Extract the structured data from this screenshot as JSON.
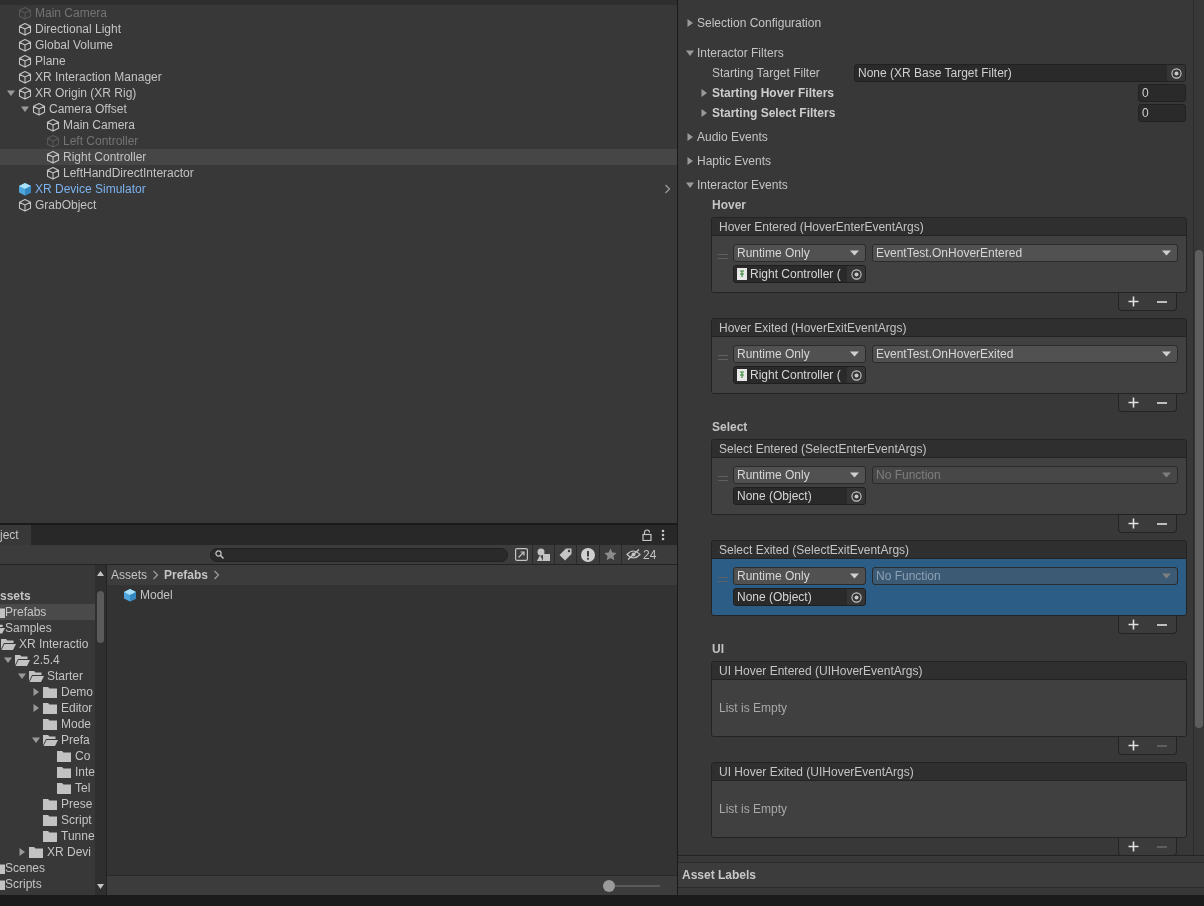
{
  "hierarchy": {
    "items": [
      {
        "label": "Main Camera",
        "kind": "object",
        "disabled": true,
        "selected": false
      },
      {
        "label": "Directional Light",
        "kind": "object",
        "disabled": false,
        "selected": false
      },
      {
        "label": "Global Volume",
        "kind": "object",
        "disabled": false,
        "selected": false
      },
      {
        "label": "Plane",
        "kind": "object",
        "disabled": false,
        "selected": false
      },
      {
        "label": "XR Interaction Manager",
        "kind": "object",
        "disabled": false,
        "selected": false
      },
      {
        "label": "XR Origin (XR Rig)",
        "kind": "object",
        "disabled": false,
        "selected": false,
        "expanded": true,
        "children": [
          {
            "label": "Camera Offset",
            "kind": "object",
            "disabled": false,
            "selected": false,
            "expanded": true,
            "children": [
              {
                "label": "Main Camera",
                "kind": "object",
                "disabled": false,
                "selected": false
              },
              {
                "label": "Left Controller",
                "kind": "object",
                "disabled": true,
                "selected": false
              },
              {
                "label": "Right Controller",
                "kind": "object",
                "disabled": false,
                "selected": true
              },
              {
                "label": "LeftHandDirectInteractor",
                "kind": "object",
                "disabled": false,
                "selected": false
              }
            ]
          }
        ]
      },
      {
        "label": "XR Device Simulator",
        "kind": "prefab",
        "disabled": false,
        "selected": false
      },
      {
        "label": "GrabObject",
        "kind": "object",
        "disabled": false,
        "selected": false
      }
    ]
  },
  "project": {
    "tab": "ject",
    "hidden_count": "24",
    "tree": {
      "header": "ssets",
      "items": [
        {
          "label": "Prefabs",
          "selected": true
        },
        {
          "label": "Samples",
          "selected": false,
          "expanded": true,
          "children": [
            {
              "label": "XR Interactio",
              "selected": false,
              "expanded": true,
              "children": [
                {
                  "label": "2.5.4",
                  "selected": false,
                  "expanded": true,
                  "children": [
                    {
                      "label": "Starter",
                      "selected": false,
                      "expanded": true,
                      "children": [
                        {
                          "label": "Demo",
                          "selected": false,
                          "expanded": false
                        },
                        {
                          "label": "Editor",
                          "selected": false,
                          "expanded": false
                        },
                        {
                          "label": "Mode",
                          "selected": false
                        },
                        {
                          "label": "Prefa",
                          "selected": false,
                          "expanded": true,
                          "children": [
                            {
                              "label": "Co",
                              "selected": false
                            },
                            {
                              "label": "Inte",
                              "selected": false
                            },
                            {
                              "label": "Tel",
                              "selected": false
                            }
                          ]
                        },
                        {
                          "label": "Prese",
                          "selected": false
                        },
                        {
                          "label": "Script",
                          "selected": false
                        },
                        {
                          "label": "Tunne",
                          "selected": false
                        }
                      ]
                    },
                    {
                      "label": "XR Devi",
                      "selected": false,
                      "expanded": false
                    }
                  ]
                }
              ]
            }
          ]
        },
        {
          "label": "Scenes",
          "selected": false
        },
        {
          "label": "Scripts",
          "selected": false
        }
      ]
    },
    "breadcrumb": [
      "Assets",
      "Prefabs"
    ],
    "assets": [
      {
        "label": "Model",
        "kind": "prefab"
      }
    ],
    "zoom": {
      "level": 0
    }
  },
  "inspector": {
    "sections": [
      {
        "label": "Selection Configuration",
        "expanded": false
      },
      {
        "label": "Interactor Filters",
        "expanded": true,
        "fields": [
          {
            "kind": "object",
            "label": "Starting Target Filter",
            "value": "None (XR Base Target Filter)"
          },
          {
            "kind": "list",
            "label": "Starting Hover Filters",
            "expanded": false,
            "value": "0"
          },
          {
            "kind": "list",
            "label": "Starting Select Filters",
            "expanded": false,
            "value": "0"
          }
        ]
      },
      {
        "label": "Audio Events",
        "expanded": false
      },
      {
        "label": "Haptic Events",
        "expanded": false
      },
      {
        "label": "Interactor Events",
        "expanded": true,
        "groups": [
          {
            "title": "Hover",
            "events": [
              {
                "title": "Hover Entered (HoverEnterEventArgs)",
                "remove_disabled": false,
                "listeners": [
                  {
                    "selected": false,
                    "call_state": "Runtime Only",
                    "function": {
                      "label": "EventTest.OnHoverEntered",
                      "disabled": false
                    },
                    "target": {
                      "label": "Right Controller (",
                      "kind": "component"
                    }
                  }
                ]
              },
              {
                "title": "Hover Exited (HoverExitEventArgs)",
                "remove_disabled": false,
                "listeners": [
                  {
                    "selected": false,
                    "call_state": "Runtime Only",
                    "function": {
                      "label": "EventTest.OnHoverExited",
                      "disabled": false
                    },
                    "target": {
                      "label": "Right Controller (",
                      "kind": "component"
                    }
                  }
                ]
              }
            ]
          },
          {
            "title": "Select",
            "events": [
              {
                "title": "Select Entered (SelectEnterEventArgs)",
                "remove_disabled": false,
                "listeners": [
                  {
                    "selected": false,
                    "call_state": "Runtime Only",
                    "function": {
                      "label": "No Function",
                      "disabled": true
                    },
                    "target": {
                      "label": "None (Object)",
                      "kind": "none"
                    }
                  }
                ]
              },
              {
                "title": "Select Exited (SelectExitEventArgs)",
                "remove_disabled": false,
                "listeners": [
                  {
                    "selected": true,
                    "call_state": "Runtime Only",
                    "function": {
                      "label": "No Function",
                      "disabled": true
                    },
                    "target": {
                      "label": "None (Object)",
                      "kind": "none"
                    }
                  }
                ]
              }
            ]
          },
          {
            "title": "UI",
            "events": [
              {
                "title": "UI Hover Entered (UIHoverEventArgs)",
                "remove_disabled": true,
                "empty_text": "List is Empty"
              },
              {
                "title": "UI Hover Exited (UIHoverEventArgs)",
                "remove_disabled": true,
                "empty_text": "List is Empty"
              }
            ]
          }
        ]
      }
    ],
    "footer": "Asset Labels"
  }
}
